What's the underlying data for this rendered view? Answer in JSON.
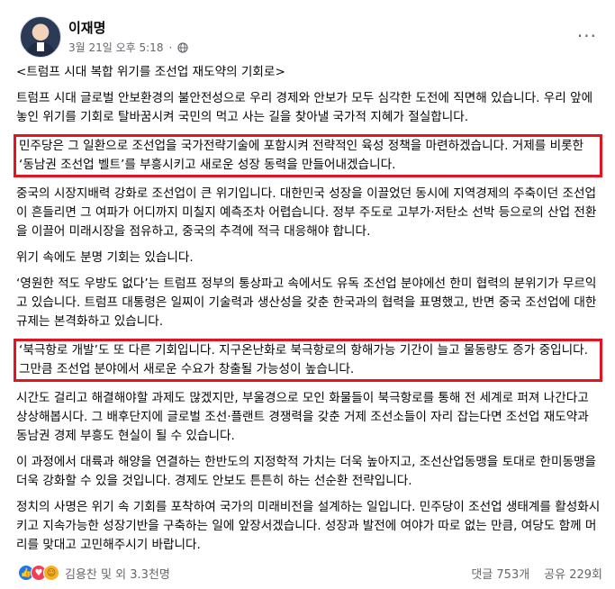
{
  "header": {
    "name": "이재명",
    "timestamp": "3월 21일 오후 5:18",
    "more_label": "···"
  },
  "title": "<트럼프 시대 복합 위기를 조선업 재도약의 기회로>",
  "paragraphs": [
    "트럼프 시대 글로벌 안보환경의 불안전성으로 우리 경제와 안보가 모두 심각한 도전에 직면해 있습니다. 우리 앞에 놓인 위기를 기회로 탈바꿈시켜 국민의 먹고 사는 길을 찾아낼 국가적 지혜가 절실합니다.",
    "민주당은 그 일환으로 조선업을 국가전략기술에 포함시켜 전략적인 육성 정책을 마련하겠습니다. 거제를 비롯한 ‘동남권 조선업 벨트’를 부흥시키고 새로운 성장 동력을 만들어내겠습니다.",
    "중국의 시장지배력 강화로 조선업이 큰 위기입니다. 대한민국 성장을 이끌었던 동시에 지역경제의 주축이던 조선업이 흔들리면 그 여파가 어디까지 미칠지 예측조차 어렵습니다. 정부 주도로 고부가·저탄소 선박 등으로의 산업 전환을 이끌어 미래시장을 점유하고, 중국의 추격에 적극 대응해야 합니다.",
    "위기 속에도 분명 기회는 있습니다.",
    "‘영원한 적도 우방도 없다’는 트럼프 정부의 통상파고 속에서도 유독 조선업 분야에선 한미 협력의 분위기가 무르익고 있습니다. 트럼프 대통령은 일찌이 기술력과 생산성을 갖춘 한국과의 협력을 표명했고, 반면 중국 조선업에 대한 규제는 본격화하고 있습니다.",
    "‘북극항로 개발’도 또 다른 기회입니다. 지구온난화로 북극항로의 항해가능 기간이 늘고 물동량도 증가 중입니다. 그만큼 조선업 분야에서 새로운 수요가 창출될 가능성이 높습니다.",
    "시간도 걸리고 해결해야할 과제도 많겠지만, 부울경으로 모인 화물들이 북극항로를 통해 전 세계로 퍼져 나간다고 상상해봅시다. 그 배후단지에 글로벌 조선·플랜트 경쟁력을 갖춘 거제 조선소들이 자리 잡는다면 조선업 재도약과 동남권 경제 부흥도 현실이 될 수 있습니다.",
    "이 과정에서 대륙과 해양을 연결하는 한반도의 지정학적 가치는 더욱 높아지고, 조선산업동맹을 토대로 한미동맹을 더욱 강화할 수 있을 것입니다. 경제도 안보도 튼튼히 하는 선순환 전략입니다.",
    "정치의 사명은 위기 속 기회를 포착하여 국가의 미래비전을 설계하는 일입니다. 민주당이 조선업 생태계를 활성화시키고 지속가능한 성장기반을 구축하는 일에 앞장서겠습니다. 성장과 발전에 여야가 따로 없는 만큼, 여당도 함께 머리를 맞대고 고민해주시기 바랍니다."
  ],
  "footer": {
    "reactions_text": "김용찬 및 외 3.3천명",
    "comments": "댓글 753개",
    "shares": "공유 229회"
  },
  "colors": {
    "highlight_border": "#e5121f",
    "meta_text": "#65676b",
    "like_blue": "#1877f2"
  }
}
